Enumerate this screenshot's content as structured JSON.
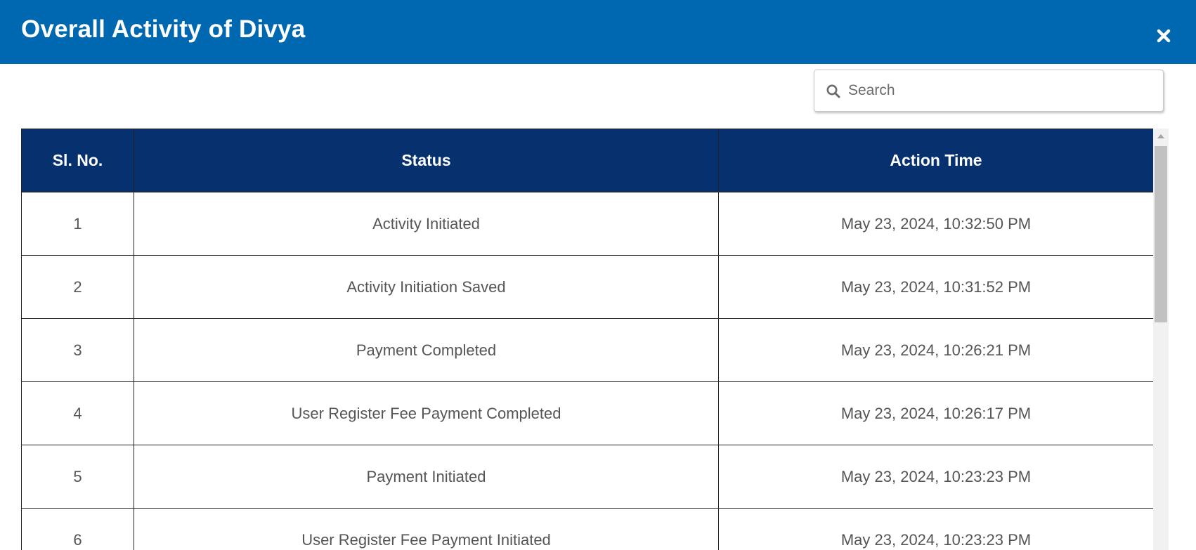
{
  "header": {
    "title": "Overall Activity of Divya",
    "close_icon": "close-icon",
    "background_color": "#0067b1"
  },
  "search": {
    "placeholder": "Search",
    "value": "",
    "icon": "search-icon"
  },
  "table": {
    "header_color": "#07306f",
    "columns": [
      "Sl. No.",
      "Status",
      "Action Time"
    ],
    "rows": [
      {
        "sl": "1",
        "status": "Activity Initiated",
        "time": "May 23, 2024, 10:32:50 PM"
      },
      {
        "sl": "2",
        "status": "Activity Initiation Saved",
        "time": "May 23, 2024, 10:31:52 PM"
      },
      {
        "sl": "3",
        "status": "Payment Completed",
        "time": "May 23, 2024, 10:26:21 PM"
      },
      {
        "sl": "4",
        "status": "User Register Fee Payment Completed",
        "time": "May 23, 2024, 10:26:17 PM"
      },
      {
        "sl": "5",
        "status": "Payment Initiated",
        "time": "May 23, 2024, 10:23:23 PM"
      },
      {
        "sl": "6",
        "status": "User Register Fee Payment Initiated",
        "time": "May 23, 2024, 10:23:23 PM"
      }
    ]
  }
}
